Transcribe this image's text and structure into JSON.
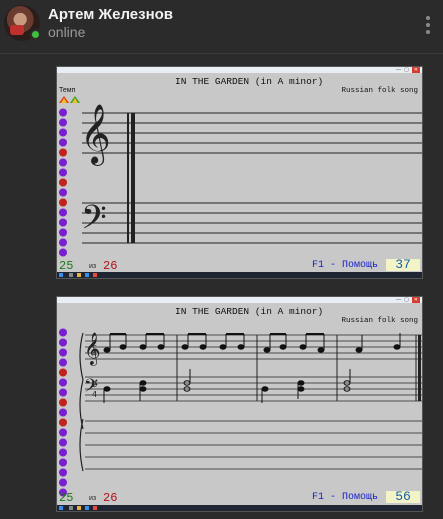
{
  "header": {
    "user_name": "Артем Железнов",
    "status": "online"
  },
  "messages": [
    {
      "title": "IN THE GARDEN (in A minor)",
      "subtitle": "Russian folk song",
      "tempo_label": "Темп",
      "measure_current": "25",
      "measure_sep": "из",
      "measure_total": "26",
      "help": "F1 - Помощь",
      "counter": "37"
    },
    {
      "title": "IN THE GARDEN (in A minor)",
      "subtitle": "Russian folk song",
      "measure_current": "25",
      "measure_sep": "из",
      "measure_total": "26",
      "help": "F1 - Помощь",
      "counter": "56"
    }
  ],
  "colors": {
    "background": "#2b2b2b",
    "online": "#3fbf3f",
    "sidebar_icon_purple": "#7a1fd0",
    "sidebar_icon_red": "#c0221c",
    "measure_current": "#1a7a1a",
    "measure_total": "#b01515",
    "help_text": "#1a22c8",
    "counter_text": "#1560a8"
  },
  "icons": [
    "kebab-menu-icon",
    "sidebar-note-icon",
    "tempo-up-icon",
    "tempo-down-icon",
    "treble-clef-icon",
    "bass-clef-icon"
  ]
}
